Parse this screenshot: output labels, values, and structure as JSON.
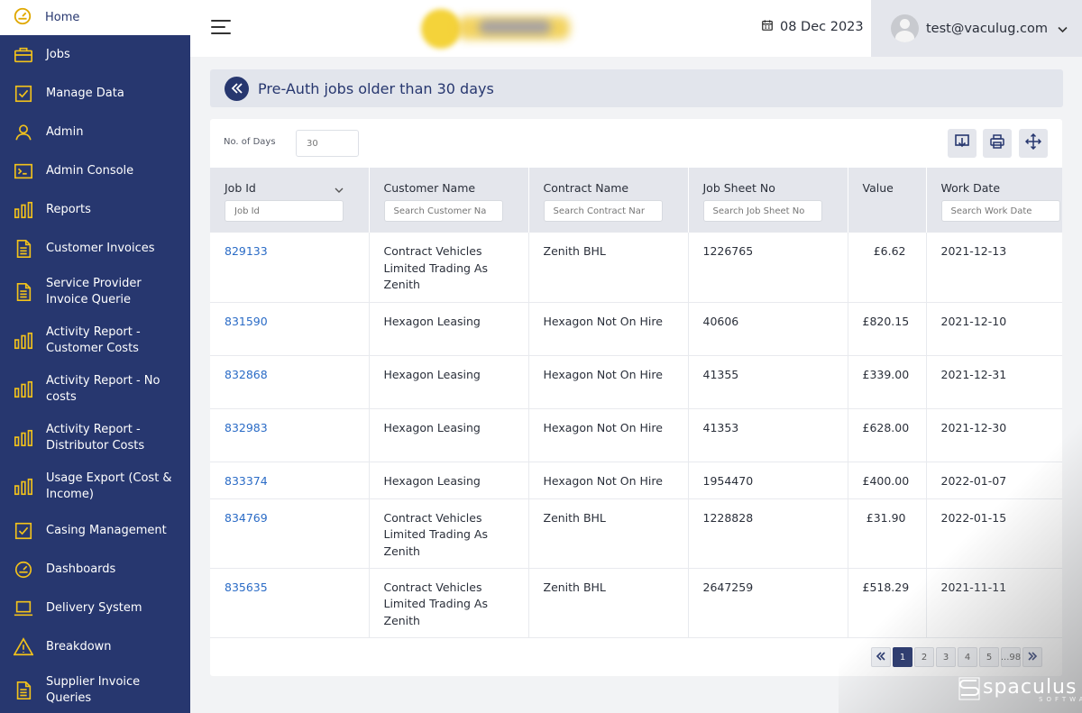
{
  "sidebar": {
    "home": {
      "label": "Home",
      "icon": "dashboard-gauge-icon"
    },
    "items": [
      {
        "label": "Jobs",
        "icon": "briefcase-icon"
      },
      {
        "label": "Manage Data",
        "icon": "checkbox-icon"
      },
      {
        "label": "Admin",
        "icon": "user-icon"
      },
      {
        "label": "Admin Console",
        "icon": "terminal-icon"
      },
      {
        "label": "Reports",
        "icon": "bar-chart-icon"
      },
      {
        "label": "Customer Invoices",
        "icon": "document-icon"
      },
      {
        "label": "Service Provider Invoice Querie",
        "icon": "document-icon"
      },
      {
        "label": "Activity Report - Customer Costs",
        "icon": "bar-chart-icon"
      },
      {
        "label": "Activity Report - No costs",
        "icon": "bar-chart-icon"
      },
      {
        "label": "Activity Report - Distributor Costs",
        "icon": "bar-chart-icon"
      },
      {
        "label": "Usage Export (Cost & Income)",
        "icon": "bar-chart-icon"
      },
      {
        "label": "Casing Management",
        "icon": "checkbox-icon"
      },
      {
        "label": "Dashboards",
        "icon": "dashboard-gauge-icon"
      },
      {
        "label": "Delivery System",
        "icon": "laptop-icon"
      },
      {
        "label": "Breakdown",
        "icon": "warning-icon"
      },
      {
        "label": "Supplier Invoice Queries",
        "icon": "document-icon"
      }
    ]
  },
  "header": {
    "date": "08 Dec 2023",
    "user_email": "test@vaculug.com"
  },
  "page": {
    "title": "Pre-Auth jobs older than 30 days"
  },
  "filters": {
    "days_label": "No. of Days",
    "days_value": "30"
  },
  "table": {
    "columns": [
      {
        "label": "Job Id",
        "placeholder": "Job Id"
      },
      {
        "label": "Customer Name",
        "placeholder": "Search Customer Na"
      },
      {
        "label": "Contract Name",
        "placeholder": "Search Contract Nar"
      },
      {
        "label": "Job Sheet No",
        "placeholder": "Search Job Sheet No"
      },
      {
        "label": "Value",
        "placeholder": ""
      },
      {
        "label": "Work Date",
        "placeholder": "Search Work Date"
      }
    ],
    "rows": [
      [
        "829133",
        "Contract Vehicles Limited Trading As Zenith",
        "Zenith BHL",
        "1226765",
        "£6.62",
        "2021-12-13"
      ],
      [
        "831590",
        "Hexagon Leasing",
        "Hexagon Not On Hire",
        "40606",
        "£820.15",
        "2021-12-10"
      ],
      [
        "832868",
        "Hexagon Leasing",
        "Hexagon Not On Hire",
        "41355",
        "£339.00",
        "2021-12-31"
      ],
      [
        "832983",
        "Hexagon Leasing",
        "Hexagon Not On Hire",
        "41353",
        "£628.00",
        "2021-12-30"
      ],
      [
        "833374",
        "Hexagon Leasing",
        "Hexagon Not On Hire",
        "1954470",
        "£400.00",
        "2022-01-07"
      ],
      [
        "834769",
        "Contract Vehicles Limited Trading As Zenith",
        "Zenith BHL",
        "1228828",
        "£31.90",
        "2022-01-15"
      ],
      [
        "835635",
        "Contract Vehicles Limited Trading As Zenith",
        "Zenith BHL",
        "2647259",
        "£518.29",
        "2021-11-11"
      ]
    ]
  },
  "pagination": {
    "pages": [
      "1",
      "2",
      "3",
      "4",
      "5",
      "...98"
    ],
    "active": "1"
  },
  "watermark": {
    "text": "spaculus",
    "sub": "SOFTWARE"
  },
  "colors": {
    "sidebar": "#27376f",
    "link": "#2a6bc6",
    "accent_icon": "#f2c21b"
  }
}
